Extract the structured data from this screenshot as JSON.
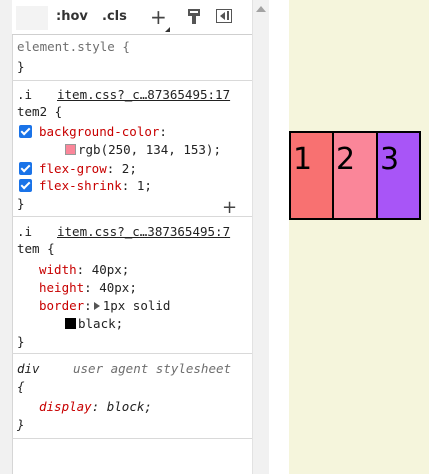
{
  "toolbar": {
    "filter_placeholder": "",
    "hov_label": ":hov",
    "cls_label": ".cls",
    "new_rule_icon": "plus-icon",
    "computed_icon": "paint-brush-icon",
    "sidebar_icon": "toggle-sidebar-icon"
  },
  "rules": {
    "element_style": {
      "selector": "element.style {",
      "close": "}"
    },
    "item2": {
      "source_prefix": ".i",
      "source_link": "item.css?_c…87365495:17",
      "selector": "tem2 {",
      "decls": [
        {
          "name": "background-color",
          "value": "rgb(250, 134, 153);",
          "swatch": "#fa8699",
          "checked": true
        },
        {
          "name": "flex-grow",
          "value": "2;",
          "checked": true
        },
        {
          "name": "flex-shrink",
          "value": "1;",
          "checked": true
        }
      ],
      "close": "}"
    },
    "item": {
      "source_prefix": ".i",
      "source_link": "item.css?_c…387365495:7",
      "selector": "tem {",
      "decls": [
        {
          "name": "width",
          "value": "40px;"
        },
        {
          "name": "height",
          "value": "40px;"
        },
        {
          "name": "border",
          "value": "1px solid",
          "value2": "black;",
          "swatch": "#000000"
        }
      ],
      "close": "}"
    },
    "div": {
      "selector": "div",
      "source": "user agent stylesheet",
      "open": "{",
      "decls": [
        {
          "name": "display",
          "value": "block;"
        }
      ],
      "close": "}"
    }
  },
  "preview": {
    "background": "#f5f5dc",
    "items": [
      {
        "label": "1",
        "color": "#f87171"
      },
      {
        "label": "2",
        "color": "#fa8699"
      },
      {
        "label": "3",
        "color": "#a855f7"
      }
    ]
  }
}
